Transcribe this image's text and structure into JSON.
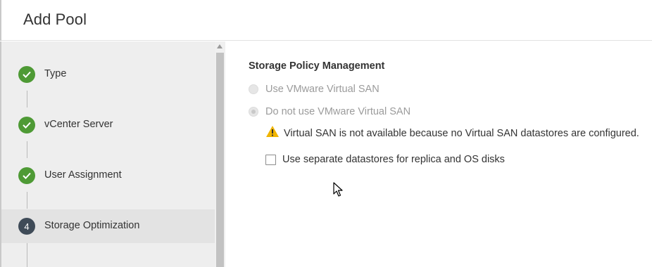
{
  "dialog": {
    "title": "Add Pool"
  },
  "wizard": {
    "steps": [
      {
        "label": "Type",
        "status": "done"
      },
      {
        "label": "vCenter Server",
        "status": "done"
      },
      {
        "label": "User Assignment",
        "status": "done"
      },
      {
        "label": "Storage Optimization",
        "status": "current",
        "number": "4"
      }
    ]
  },
  "storage": {
    "section_title": "Storage Policy Management",
    "option_use_vsan": "Use VMware Virtual SAN",
    "option_no_vsan": "Do not use VMware Virtual SAN",
    "warning": "Virtual SAN is not available because no Virtual SAN datastores are configured.",
    "separate_datastores_label": "Use separate datastores for replica and OS disks",
    "separate_datastores_checked": false
  },
  "colors": {
    "step_done": "#4e9a35",
    "step_current": "#3f4b58",
    "warning": "#f0b400"
  },
  "icons": {
    "step_done": "check-icon",
    "warning": "warning-triangle-icon",
    "cursor": "mouse-pointer-icon"
  }
}
